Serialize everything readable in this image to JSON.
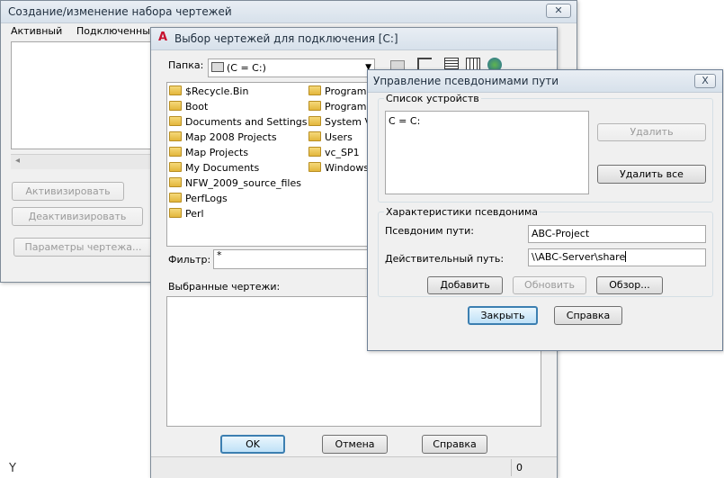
{
  "win1": {
    "title": "Создание/изменение набора чертежей",
    "col_active": "Активный",
    "col_connected": "Подключенные ч",
    "scroll_left_arrow": "◂",
    "activate_label": "Активизировать",
    "deactivate_label": "Деактивизировать",
    "params_label": "Параметры чертежа..."
  },
  "win2": {
    "title": "Выбор чертежей для подключения [C:]",
    "folder_label": "Папка:",
    "folder_value": "(C = C:)",
    "folders_col1": [
      "$Recycle.Bin",
      "Boot",
      "Documents and Settings",
      "Map 2008 Projects",
      "Map Projects",
      "My Documents",
      "NFW_2009_source_files",
      "PerfLogs",
      "Perl"
    ],
    "folders_col2": [
      "Program F",
      "ProgramDa",
      "System Vo",
      "Users",
      "vc_SP1",
      "Windows"
    ],
    "filter_label": "Фильтр:",
    "filter_value": "*",
    "selected_label": "Выбранные чертежи:",
    "ok_label": "OK",
    "cancel_label": "Отмена",
    "help_label": "Справка",
    "status_count": "0"
  },
  "win3": {
    "title": "Управление псевдонимами пути",
    "close_glyph": "X",
    "devices_group": "Список устройств",
    "devices": [
      "C = C:"
    ],
    "delete_label": "Удалить",
    "delete_all_label": "Удалить все",
    "alias_group": "Характеристики псевдонима",
    "alias_label": "Псевдоним пути:",
    "alias_value": "ABC-Project",
    "real_path_label": "Действительный путь:",
    "real_path_value": "\\\\ABC-Server\\share",
    "add_label": "Добавить",
    "update_label": "Обновить",
    "browse_label": "Обзор...",
    "close_label": "Закрыть",
    "help_label": "Справка"
  },
  "cursor": {
    "glyph": "Y"
  }
}
